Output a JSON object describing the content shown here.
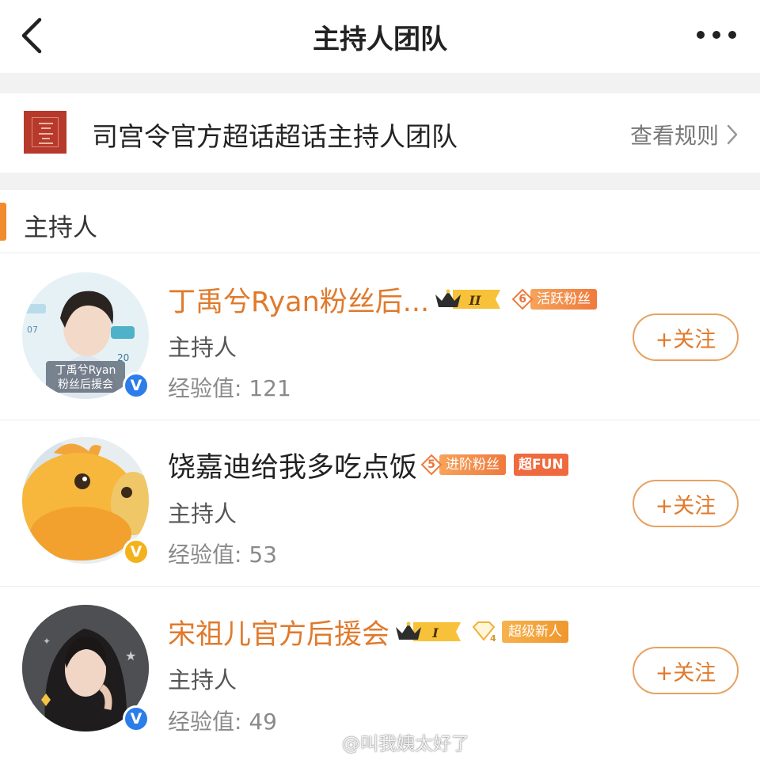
{
  "nav": {
    "title": "主持人团队"
  },
  "topic": {
    "name": "司宫令官方超话超话主持人团队",
    "view_rules": "查看规则"
  },
  "section": {
    "title": "主持人"
  },
  "members": [
    {
      "name": "丁禹兮Ryan粉丝后...",
      "crown_level": "II",
      "fan_level": "6",
      "fan_badge": "活跃粉丝",
      "role": "主持人",
      "exp": "经验值: 121",
      "follow": "+关注",
      "avatar_caption": [
        "丁禹兮Ryan",
        "粉丝后援会"
      ],
      "verify_color": "#2b7de9"
    },
    {
      "name": "饶嘉迪给我多吃点饭",
      "fan_level": "5",
      "fan_badge": "进阶粉丝",
      "tag": "超FUN",
      "role": "主持人",
      "exp": "经验值: 53",
      "follow": "+关注",
      "verify_color": "#f3b21c"
    },
    {
      "name": "宋祖儿官方后援会",
      "crown_level": "I",
      "fan_level": "4",
      "fan_badge": "超级新人",
      "role": "主持人",
      "exp": "经验值: 49",
      "follow": "+关注",
      "verify_color": "#2b7de9"
    }
  ],
  "watermark": "@叫我姨太好了",
  "colors": {
    "accent": "#f28a2e",
    "name_orange": "#e07a2c",
    "verify_blue": "#2b7de9",
    "verify_gold": "#f3b21c"
  }
}
